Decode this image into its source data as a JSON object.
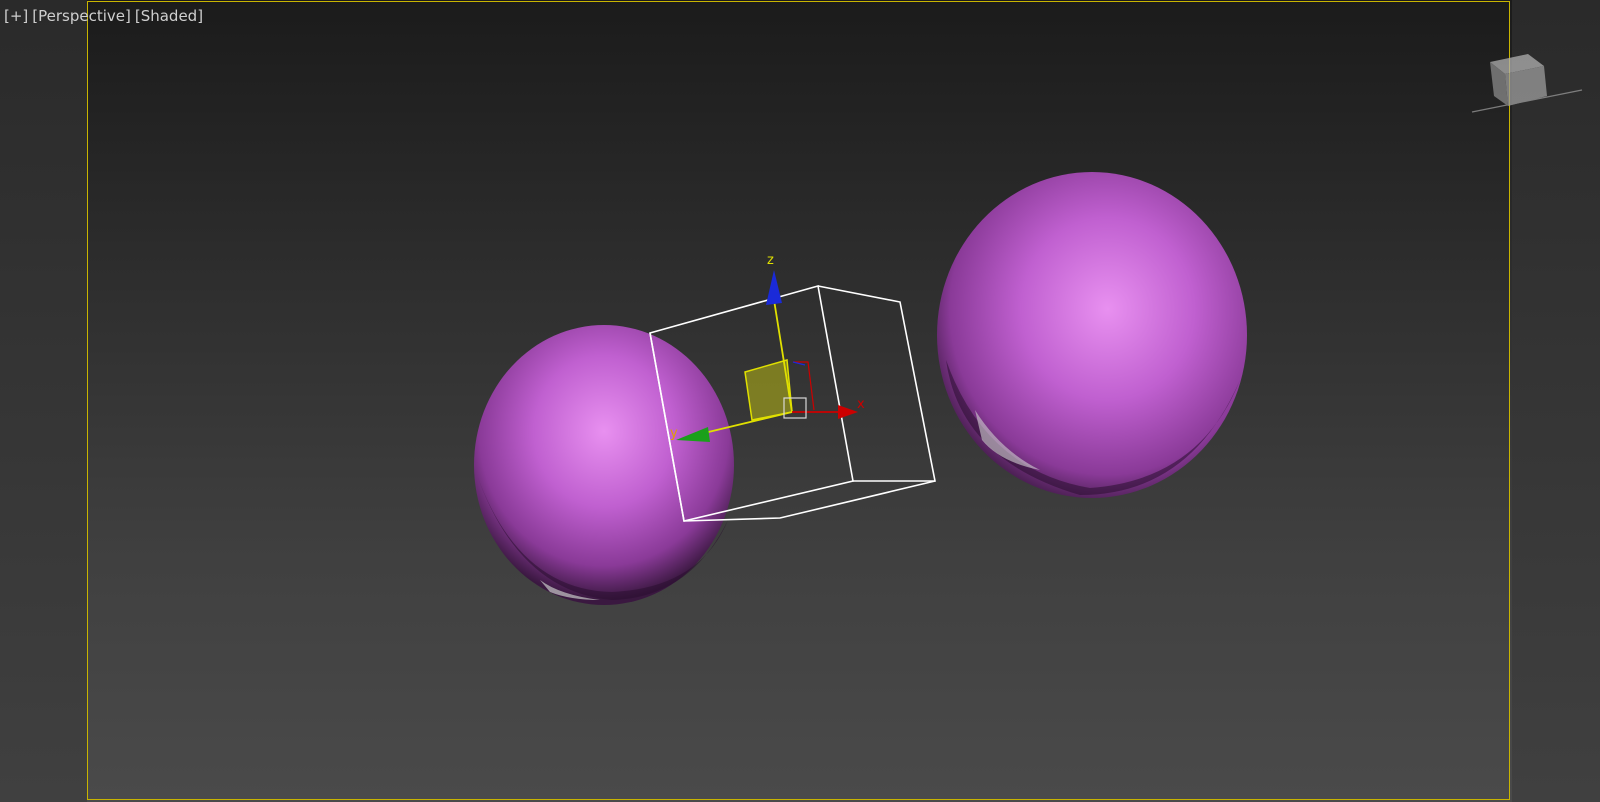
{
  "viewport": {
    "labels": {
      "plus": "[+]",
      "view": "[Perspective]",
      "shading": "[Shaded]"
    },
    "gizmo_axes": {
      "x": "x",
      "y": "y",
      "z": "z"
    },
    "colors": {
      "frame": "#c8b400",
      "sphere": "#c060d0",
      "x_axis": "#cc0000",
      "y_axis": "#1aa01a",
      "z_axis": "#1a2ad8",
      "selected_axis": "#e0e000",
      "plane_handle": "#8a8a20"
    },
    "viewcube_icon": "viewcube-icon",
    "objects": [
      "sphere-left",
      "sphere-right",
      "selected-box"
    ]
  }
}
